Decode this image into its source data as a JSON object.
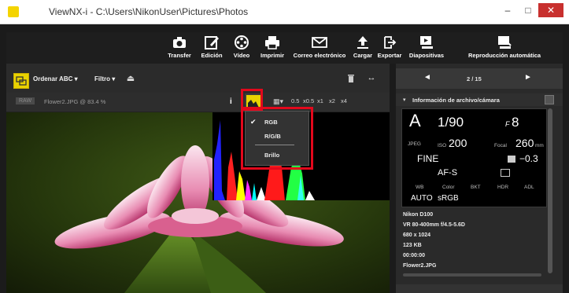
{
  "window": {
    "title": "ViewNX-i - C:\\Users\\NikonUser\\Pictures\\Photos",
    "minimize": "–",
    "maximize": "□",
    "close": "✕"
  },
  "toolbar": {
    "items": [
      {
        "label": "Transfer",
        "icon": "camera-icon"
      },
      {
        "label": "Edición",
        "icon": "edit-icon"
      },
      {
        "label": "Vídeo",
        "icon": "film-reel-icon"
      },
      {
        "label": "Imprimir",
        "icon": "printer-icon"
      },
      {
        "label": "Correo electrónico",
        "icon": "mail-icon"
      },
      {
        "label": "Cargar",
        "icon": "upload-icon"
      },
      {
        "label": "Exportar",
        "icon": "export-icon"
      },
      {
        "label": "Diapositivas",
        "icon": "slideshow-icon"
      },
      {
        "label": "Reproducción automática",
        "icon": "autoplay-icon"
      }
    ]
  },
  "browser": {
    "sort_label": "Ordenar ABC",
    "filter_label": "Filtro",
    "raw_badge": "RAW",
    "file_label": "Flower2.JPG @ 83.4 %",
    "info_button": "i",
    "zoom_levels": [
      "0.5",
      "x0.5",
      "x1",
      "x2",
      "x4"
    ]
  },
  "histogram_menu": {
    "items": [
      {
        "label": "RGB",
        "checked": true
      },
      {
        "label": "R/G/B",
        "checked": false
      },
      {
        "label": "Brillo",
        "checked": false
      }
    ]
  },
  "nav": {
    "prev": "◄",
    "counter": "2 / 15",
    "next": "►"
  },
  "info_panel": {
    "title": "Información de archivo/cámara",
    "mode": "A",
    "shutter": "1/90",
    "aperture_prefix": "F",
    "aperture": "8",
    "format": "JPEG",
    "iso_label": "ISO",
    "iso": "200",
    "focal_label": "Focal",
    "focal": "260",
    "focal_unit": "mm",
    "quality": "FINE",
    "exposure_comp": "−0.3",
    "focus_mode": "AF-S",
    "labels": [
      "WB",
      "Color",
      "BKT",
      "HDR",
      "ADL"
    ],
    "wb": "AUTO",
    "color": "sRGB",
    "camera": "Nikon D100",
    "lens": "VR 80-400mm f/4.5-5.6D",
    "dimensions": "680 x 1024",
    "size": "123 KB",
    "time": "00:00:00",
    "file": "Flower2.JPG"
  },
  "colors": {
    "accent_yellow": "#e9d200",
    "highlight_red": "#e3081c"
  }
}
